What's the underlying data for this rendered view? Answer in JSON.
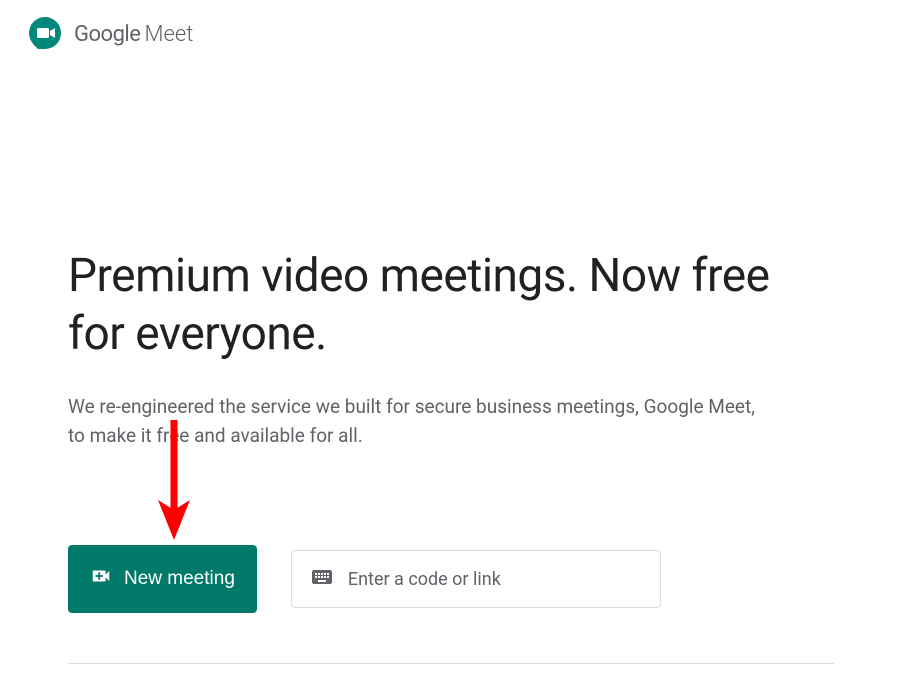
{
  "header": {
    "logo_google": "Google",
    "logo_meet": "Meet"
  },
  "main": {
    "headline": "Premium video meetings. Now free for everyone.",
    "subtext": "We re-engineered the service we built for secure business meetings, Google Meet, to make it free and available for all.",
    "new_meeting_label": "New meeting",
    "code_input_placeholder": "Enter a code or link"
  },
  "colors": {
    "primary": "#00796b",
    "arrow": "#ff0000"
  }
}
